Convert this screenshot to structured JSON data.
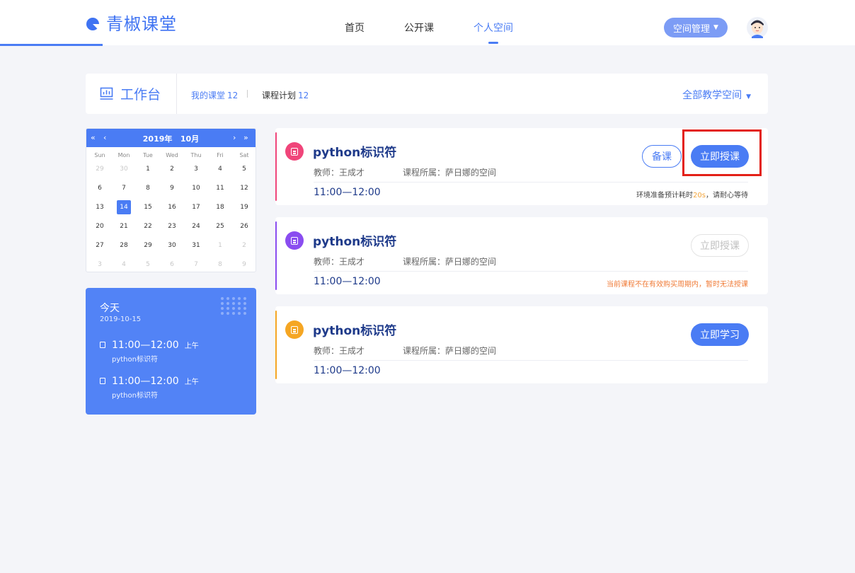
{
  "header": {
    "logo_text": "青椒课堂",
    "nav": [
      "首页",
      "公开课",
      "个人空间"
    ],
    "active_nav": "个人空间",
    "space_button": "空间管理"
  },
  "workbench": {
    "title": "工作台",
    "tabs": [
      {
        "label": "我的课堂",
        "count": "12"
      },
      {
        "label": "课程计划",
        "count": "12"
      }
    ],
    "all_spaces": "全部教学空间"
  },
  "calendar": {
    "year_label": "2019年",
    "month_label": "10月",
    "weekdays": [
      "Sun",
      "Mon",
      "Tue",
      "Wed",
      "Thu",
      "Fri",
      "Sat"
    ],
    "weeks": [
      [
        "29",
        "30",
        "1",
        "2",
        "3",
        "4",
        "5"
      ],
      [
        "6",
        "7",
        "8",
        "9",
        "10",
        "11",
        "12"
      ],
      [
        "13",
        "14",
        "15",
        "16",
        "17",
        "18",
        "19"
      ],
      [
        "20",
        "21",
        "22",
        "23",
        "24",
        "25",
        "26"
      ],
      [
        "27",
        "28",
        "29",
        "30",
        "31",
        "1",
        "2"
      ],
      [
        "3",
        "4",
        "5",
        "6",
        "7",
        "8",
        "9"
      ]
    ],
    "selected_day": "14"
  },
  "today": {
    "title": "今天",
    "date": "2019-10-15",
    "items": [
      {
        "time": "11:00—12:00",
        "period": "上午",
        "name": "python标识符"
      },
      {
        "time": "11:00—12:00",
        "period": "上午",
        "name": "python标识符"
      }
    ]
  },
  "courses": [
    {
      "title": "python标识符",
      "teacher": "教师：王成才",
      "space": "课程所属：萨日娜的空间",
      "time": "11:00—12:00",
      "prepare_label": "备课",
      "action_label": "立即授课",
      "note_before": "环境准备预计耗时",
      "note_highlight": "20s",
      "note_after": "，请耐心等待",
      "accent": "#f0457a"
    },
    {
      "title": "python标识符",
      "teacher": "教师：王成才",
      "space": "课程所属：萨日娜的空间",
      "time": "11:00—12:00",
      "action_label": "立即授课",
      "note": "当前课程不在有效购买周期内，暂时无法授课",
      "accent": "#8a4df0"
    },
    {
      "title": "python标识符",
      "teacher": "教师：王成才",
      "space": "课程所属：萨日娜的空间",
      "time": "11:00—12:00",
      "action_label": "立即学习",
      "accent": "#f5a623"
    }
  ]
}
